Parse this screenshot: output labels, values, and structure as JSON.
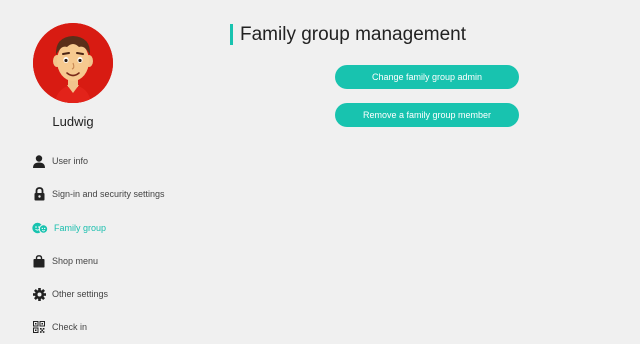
{
  "user": {
    "name": "Ludwig"
  },
  "sidebar": {
    "items": [
      {
        "label": "User info",
        "icon": "user-icon"
      },
      {
        "label": "Sign-in and security settings",
        "icon": "lock-icon"
      },
      {
        "label": "Family group",
        "icon": "family-icon",
        "active": true
      },
      {
        "label": "Shop menu",
        "icon": "shopping-bag-icon"
      },
      {
        "label": "Other settings",
        "icon": "gear-icon"
      },
      {
        "label": "Check in",
        "icon": "qr-code-icon"
      }
    ]
  },
  "main": {
    "title": "Family group management",
    "buttons": {
      "change_admin": "Change family group admin",
      "remove_member": "Remove a family group member"
    }
  },
  "colors": {
    "accent": "#18c3af",
    "background": "#f0f0f0",
    "avatar_bg": "#d81b12"
  }
}
